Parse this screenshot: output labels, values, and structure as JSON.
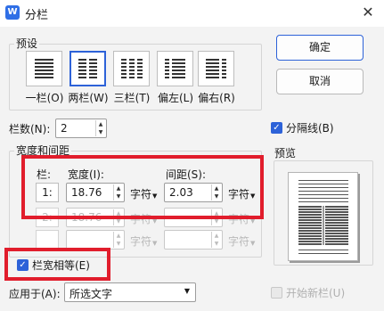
{
  "window": {
    "title": "分栏",
    "app_icon": "W",
    "close_glyph": "✕"
  },
  "presets": {
    "label": "预设",
    "items": [
      {
        "label": "一栏(O)",
        "icon": "one-column-icon"
      },
      {
        "label": "两栏(W)",
        "icon": "two-columns-icon",
        "selected": true
      },
      {
        "label": "三栏(T)",
        "icon": "three-columns-icon"
      },
      {
        "label": "偏左(L)",
        "icon": "left-column-icon"
      },
      {
        "label": "偏右(R)",
        "icon": "right-column-icon"
      }
    ]
  },
  "buttons": {
    "ok": "确定",
    "cancel": "取消"
  },
  "column_count": {
    "label": "栏数(N):",
    "value": "2"
  },
  "separator": {
    "label": "分隔线(B)",
    "checked": true
  },
  "width_spacing": {
    "label": "宽度和间距",
    "col_header": "栏:",
    "width_header": "宽度(I):",
    "spacing_header": "间距(S):",
    "unit_label": "字符",
    "rows": [
      {
        "num": "1:",
        "width": "18.76",
        "spacing": "2.03",
        "enabled": true
      },
      {
        "num": "2:",
        "width": "18.76",
        "spacing": "",
        "enabled": false
      },
      {
        "num": "",
        "width": "",
        "spacing": "",
        "enabled": false
      }
    ]
  },
  "equal_width": {
    "label": "栏宽相等(E)",
    "checked": true
  },
  "preview": {
    "label": "预览"
  },
  "apply_to": {
    "label": "应用于(A):",
    "value": "所选文字"
  },
  "new_column": {
    "label": "开始新栏(U)",
    "checked": false,
    "enabled": false
  },
  "colors": {
    "accent": "#2d62d8",
    "highlight": "#e11d2c"
  }
}
